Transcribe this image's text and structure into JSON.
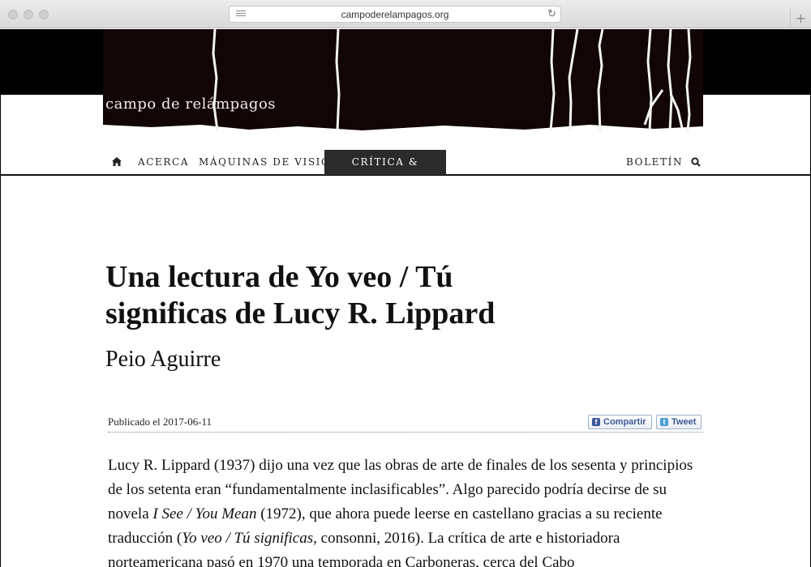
{
  "browser": {
    "url": "campoderelampagos.org",
    "reload_icon": "reload-icon",
    "new_tab": "+"
  },
  "site": {
    "title": "campo de relámpagos"
  },
  "nav": {
    "home_icon": "home-icon",
    "items": [
      "Acerca",
      "Máquinas de visión",
      "Crítica & Reviews"
    ],
    "active": "Crítica & Reviews",
    "newsletter": "Boletín",
    "search_icon": "search-icon"
  },
  "article": {
    "title": "Una lectura de Yo veo / Tú significas de Lucy R. Lippard",
    "author": "Peio Aguirre",
    "published": "Publicado el 2017-06-11",
    "share_facebook": "Compartir",
    "share_twitter": "Tweet",
    "body": {
      "p1_part1": "Lucy R. Lippard (1937) dijo una vez que las obras de arte de finales de los sesenta y principios de los setenta eran “fundamentalmente inclasificables”. Algo parecido podría decirse de su novela ",
      "p1_em1": "I See / You Mean",
      "p1_part2": " (1972), que ahora puede leerse en castellano gracias a su reciente traducción (",
      "p1_em2": "Yo veo / Tú significas",
      "p1_part3": ", consonni, 2016). La crítica de arte e historiadora norteamericana pasó en 1970 una temporada en Carboneras, cerca del Cabo"
    }
  },
  "colors": {
    "banner": "#000000",
    "nav_active_bg": "#2b2b2b",
    "share_text": "#3b5998",
    "twitter": "#4a9fd4"
  }
}
